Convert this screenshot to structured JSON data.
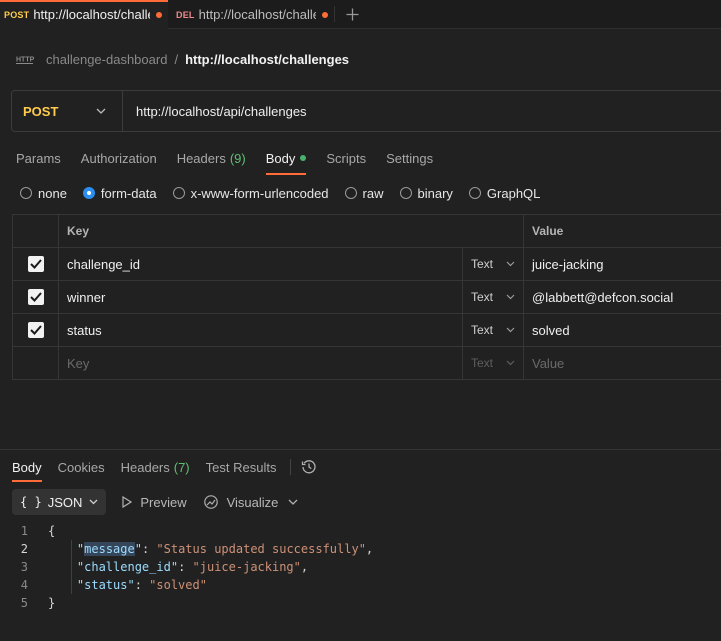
{
  "tabs": [
    {
      "method": "POST",
      "url": "http://localhost/challenges",
      "active": true,
      "unsaved": true
    },
    {
      "method": "DEL",
      "url": "http://localhost/challenges",
      "active": false,
      "unsaved": true
    }
  ],
  "breadcrumb": {
    "collection": "challenge-dashboard",
    "separator": "/",
    "request": "http://localhost/challenges"
  },
  "request": {
    "method": "POST",
    "url": "http://localhost/api/challenges"
  },
  "request_tabs": [
    {
      "label": "Params"
    },
    {
      "label": "Authorization"
    },
    {
      "label": "Headers",
      "count": "(9)"
    },
    {
      "label": "Body",
      "active": true
    },
    {
      "label": "Scripts"
    },
    {
      "label": "Settings"
    }
  ],
  "body_types": [
    "none",
    "form-data",
    "x-www-form-urlencoded",
    "raw",
    "binary",
    "GraphQL"
  ],
  "body_type_selected": "form-data",
  "form_table": {
    "headers": {
      "key": "Key",
      "value": "Value"
    },
    "rows": [
      {
        "checked": true,
        "key": "challenge_id",
        "type": "Text",
        "value": "juice-jacking"
      },
      {
        "checked": true,
        "key": "winner",
        "type": "Text",
        "value": "@labbett@defcon.social"
      },
      {
        "checked": true,
        "key": "status",
        "type": "Text",
        "value": "solved"
      }
    ],
    "placeholder": {
      "key": "Key",
      "type": "Text",
      "value": "Value"
    }
  },
  "response_tabs": [
    {
      "label": "Body",
      "active": true
    },
    {
      "label": "Cookies"
    },
    {
      "label": "Headers",
      "count": "(7)"
    },
    {
      "label": "Test Results"
    }
  ],
  "view": {
    "format": "JSON",
    "braces": "{ }",
    "preview": "Preview",
    "visualize": "Visualize"
  },
  "response_body": {
    "line_numbers": [
      "1",
      "2",
      "3",
      "4",
      "5"
    ],
    "open": "{",
    "close": "}",
    "entries": [
      {
        "key": "\"message\"",
        "value": "\"Status updated successfully\"",
        "comma": ","
      },
      {
        "key": "\"challenge_id\"",
        "value": "\"juice-jacking\"",
        "comma": ","
      },
      {
        "key": "\"status\"",
        "value": "\"solved\"",
        "comma": ""
      }
    ]
  },
  "colors": {
    "accent": "#ff6c37",
    "post": "#ffcc4d",
    "delete": "#f08a8a",
    "radio": "#2b8ef0",
    "count": "#5fbf74"
  },
  "icons": [
    "http-icon",
    "plus-icon",
    "chevron-down-icon",
    "checkbox-icon",
    "history-icon",
    "play-icon",
    "visualize-icon"
  ]
}
